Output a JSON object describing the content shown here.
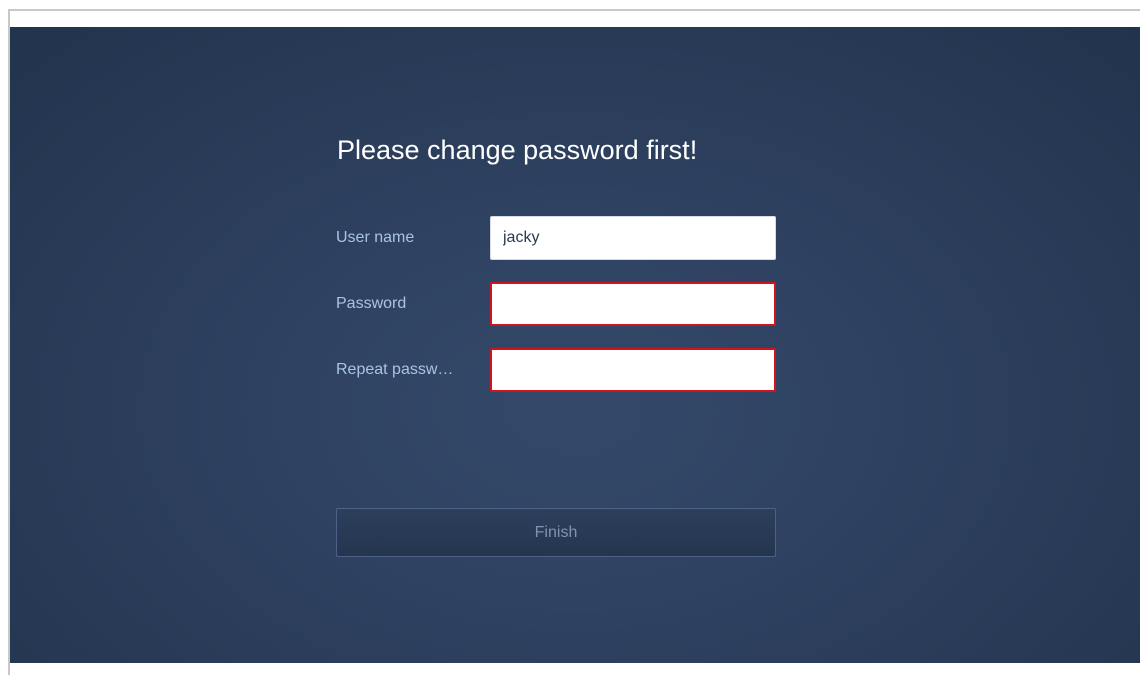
{
  "dialog": {
    "title": "Please change password first!",
    "fields": {
      "username": {
        "label": "User name",
        "value": "jacky",
        "placeholder": ""
      },
      "password": {
        "label": "Password",
        "value": "",
        "placeholder": ""
      },
      "repeat_password": {
        "label": "Repeat passw…",
        "value": "",
        "placeholder": ""
      }
    },
    "finish_label": "Finish"
  },
  "colors": {
    "background": "#2f4262",
    "title_text": "#ffffff",
    "label_text": "#a9c3e6",
    "error_border": "#d0141e",
    "button_text_disabled": "#7f93b0"
  }
}
